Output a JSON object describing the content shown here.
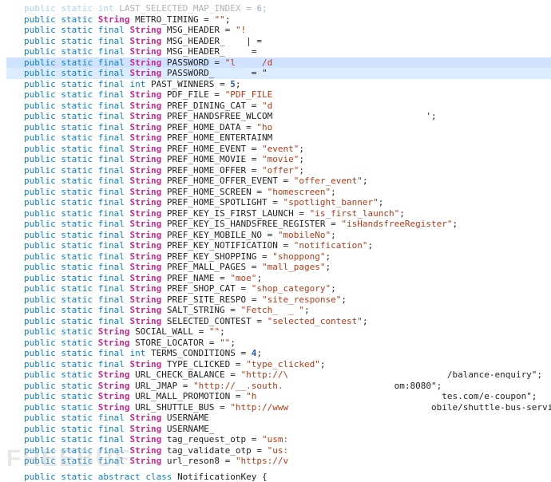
{
  "watermark": "FREEBUF",
  "code": {
    "lines": [
      {
        "indent": 1,
        "mods": "public static ",
        "type": "int",
        "sp": " ",
        "name": "LAST_SELECTED_MAP_INDEX",
        "eq": " = ",
        "valkind": "num",
        "val": "6",
        "tail": ";",
        "faded": true
      },
      {
        "indent": 1,
        "mods": "public static ",
        "type": "String",
        "sp": " ",
        "name": "METRO_TIMING",
        "eq": " = ",
        "valkind": "str",
        "val": "\"\"",
        "tail": ";"
      },
      {
        "indent": 1,
        "mods": "public static final ",
        "type": "String",
        "sp": " ",
        "name": "MSG_HEADER",
        "eq": " = ",
        "valkind": "str",
        "val": "\"!",
        "tail": ""
      },
      {
        "indent": 1,
        "mods": "public static final ",
        "type": "String",
        "sp": " ",
        "name": "MSG_HEADER_",
        "eq": "",
        "valkind": "",
        "val": "",
        "tail": "    | ="
      },
      {
        "indent": 1,
        "mods": "public static final ",
        "type": "String",
        "sp": " ",
        "name": "MSG_HEADER_",
        "eq": "",
        "valkind": "",
        "val": "",
        "tail": "     ="
      },
      {
        "indent": 1,
        "hl": true,
        "mods": "public static final ",
        "type": "String",
        "sp": " ",
        "name": "PASSWORD",
        "eq": " = ",
        "valkind": "str",
        "val": "\"l     /d",
        "tail": ""
      },
      {
        "indent": 1,
        "hl2": true,
        "mods": "public static final ",
        "type": "String",
        "sp": " ",
        "name": "PASSWORD_",
        "eq": "",
        "valkind": "",
        "val": "",
        "tail": "       = \""
      },
      {
        "indent": 1,
        "mods": "public static final ",
        "type": "int",
        "sp": " ",
        "name": "PAST_WINNERS",
        "eq": " = ",
        "valkind": "num",
        "val": "5",
        "tail": ";"
      },
      {
        "indent": 1,
        "mods": "public static final ",
        "type": "String",
        "sp": " ",
        "name": "PDF_FILE",
        "eq": " = ",
        "valkind": "str",
        "val": "\"PDF_FILE",
        "tail": ""
      },
      {
        "indent": 1,
        "mods": "public static final ",
        "type": "String",
        "sp": " ",
        "name": "PREF_DINING_CAT",
        "eq": " = ",
        "valkind": "str",
        "val": "\"d",
        "tail": ""
      },
      {
        "indent": 1,
        "mods": "public static final ",
        "type": "String",
        "sp": " ",
        "name": "PREF_HANDSFREE_WLCOM",
        "eq": "",
        "valkind": "",
        "val": "",
        "tail": "                             ';"
      },
      {
        "indent": 1,
        "mods": "public static final ",
        "type": "String",
        "sp": " ",
        "name": "PREF_HOME_DATA",
        "eq": " = ",
        "valkind": "str",
        "val": "\"ho",
        "tail": ""
      },
      {
        "indent": 1,
        "mods": "public static final ",
        "type": "String",
        "sp": " ",
        "name": "PREF_HOME_ENTERTAINM",
        "eq": "",
        "valkind": "",
        "val": "",
        "tail": ""
      },
      {
        "indent": 1,
        "mods": "public static final ",
        "type": "String",
        "sp": " ",
        "name": "PREF_HOME_EVENT",
        "eq": " = ",
        "valkind": "str",
        "val": "\"event\"",
        "tail": ";"
      },
      {
        "indent": 1,
        "mods": "public static final ",
        "type": "String",
        "sp": " ",
        "name": "PREF_HOME_MOVIE",
        "eq": " = ",
        "valkind": "str",
        "val": "\"movie\"",
        "tail": ";"
      },
      {
        "indent": 1,
        "mods": "public static final ",
        "type": "String",
        "sp": " ",
        "name": "PREF_HOME_OFFER",
        "eq": " = ",
        "valkind": "str",
        "val": "\"offer\"",
        "tail": ";"
      },
      {
        "indent": 1,
        "mods": "public static final ",
        "type": "String",
        "sp": " ",
        "name": "PREF_HOME_OFFER_EVENT",
        "eq": " = ",
        "valkind": "str",
        "val": "\"offer_event\"",
        "tail": ";"
      },
      {
        "indent": 1,
        "mods": "public static final ",
        "type": "String",
        "sp": " ",
        "name": "PREF_HOME_SCREEN",
        "eq": " = ",
        "valkind": "str",
        "val": "\"homescreen\"",
        "tail": ";"
      },
      {
        "indent": 1,
        "mods": "public static final ",
        "type": "String",
        "sp": " ",
        "name": "PREF_HOME_SPOTLIGHT",
        "eq": " = ",
        "valkind": "str",
        "val": "\"spotlight_banner\"",
        "tail": ";"
      },
      {
        "indent": 1,
        "mods": "public static final ",
        "type": "String",
        "sp": " ",
        "name": "PREF_KEY_IS_FIRST_LAUNCH",
        "eq": " = ",
        "valkind": "str",
        "val": "\"is_first_launch\"",
        "tail": ";"
      },
      {
        "indent": 1,
        "mods": "public static final ",
        "type": "String",
        "sp": " ",
        "name": "PREF_KEY_IS_HANDSFREE_REGISTER",
        "eq": " = ",
        "valkind": "str",
        "val": "\"isHandsfreeRegister\"",
        "tail": ";"
      },
      {
        "indent": 1,
        "mods": "public static final ",
        "type": "String",
        "sp": " ",
        "name": "PREF_KEY_MOBILE_NO",
        "eq": " = ",
        "valkind": "str",
        "val": "\"mobileNo\"",
        "tail": ";"
      },
      {
        "indent": 1,
        "mods": "public static final ",
        "type": "String",
        "sp": " ",
        "name": "PREF_KEY_NOTIFICATION",
        "eq": " = ",
        "valkind": "str",
        "val": "\"notification\"",
        "tail": ";"
      },
      {
        "indent": 1,
        "mods": "public static final ",
        "type": "String",
        "sp": " ",
        "name": "PREF_KEY_SHOPPING",
        "eq": " = ",
        "valkind": "str",
        "val": "\"shoppong\"",
        "tail": ";"
      },
      {
        "indent": 1,
        "mods": "public static final ",
        "type": "String",
        "sp": " ",
        "name": "PREF_MALL_PAGES",
        "eq": " = ",
        "valkind": "str",
        "val": "\"mall_pages\"",
        "tail": ";"
      },
      {
        "indent": 1,
        "mods": "public static final ",
        "type": "String",
        "sp": " ",
        "name": "PREF_NAME",
        "eq": " = ",
        "valkind": "str",
        "val": "\"moe\"",
        "tail": ";"
      },
      {
        "indent": 1,
        "mods": "public static final ",
        "type": "String",
        "sp": " ",
        "name": "PREF_SHOP_CAT",
        "eq": " = ",
        "valkind": "str",
        "val": "\"shop_category\"",
        "tail": ";"
      },
      {
        "indent": 1,
        "mods": "public static final ",
        "type": "String",
        "sp": " ",
        "name": "PREF_SITE_RESPO",
        "eq": " = ",
        "valkind": "str",
        "val": "\"site_response\"",
        "tail": ";"
      },
      {
        "indent": 1,
        "mods": "public static final ",
        "type": "String",
        "sp": " ",
        "name": "SALT_STRING",
        "eq": " = ",
        "valkind": "str",
        "val": "\"Fetch_  _ \"",
        "tail": ";"
      },
      {
        "indent": 1,
        "mods": "public static final ",
        "type": "String",
        "sp": " ",
        "name": "SELECTED_CONTEST",
        "eq": " = ",
        "valkind": "str",
        "val": "\"selected_contest\"",
        "tail": ";"
      },
      {
        "indent": 1,
        "mods": "public static ",
        "type": "String",
        "sp": " ",
        "name": "SOCIAL_WALL",
        "eq": " = ",
        "valkind": "str",
        "val": "\"\"",
        "tail": ";"
      },
      {
        "indent": 1,
        "mods": "public static ",
        "type": "String",
        "sp": " ",
        "name": "STORE_LOCATOR",
        "eq": " = ",
        "valkind": "str",
        "val": "\"\"",
        "tail": ";"
      },
      {
        "indent": 1,
        "mods": "public static final ",
        "type": "int",
        "sp": " ",
        "name": "TERMS_CONDITIONS",
        "eq": " = ",
        "valkind": "num",
        "val": "4",
        "tail": ";"
      },
      {
        "indent": 1,
        "mods": "public static final ",
        "type": "String",
        "sp": " ",
        "name": "TYPE_CLICKED",
        "eq": " = ",
        "valkind": "str",
        "val": "\"type_clicked\"",
        "tail": ";"
      },
      {
        "indent": 1,
        "mods": "public static ",
        "type": "String",
        "sp": " ",
        "name": "URL_CHECK_BALANCE",
        "eq": " = ",
        "valkind": "str",
        "val": "\"http://\\",
        "tail": "                              /balance-enquiry\";"
      },
      {
        "indent": 1,
        "mods": "public static ",
        "type": "String",
        "sp": " ",
        "name": "URL_JMAP",
        "eq": " = ",
        "valkind": "str",
        "val": "\"http://__.south.",
        "tail": "                     om:8080\";"
      },
      {
        "indent": 1,
        "mods": "public static ",
        "type": "String",
        "sp": " ",
        "name": "URL_MALL_PROMOTION",
        "eq": " = ",
        "valkind": "str",
        "val": "\"h",
        "tail": "                                   tes.com/e-coupon\";"
      },
      {
        "indent": 1,
        "mods": "public static ",
        "type": "String",
        "sp": " ",
        "name": "URL_SHUTTLE_BUS",
        "eq": " = ",
        "valkind": "str",
        "val": "\"http://www",
        "tail": "                           obile/shuttle-bus-service\";"
      },
      {
        "indent": 1,
        "mods": "public static final ",
        "type": "String",
        "sp": " ",
        "name": "USERNAME",
        "eq": "",
        "valkind": "",
        "val": "",
        "tail": ""
      },
      {
        "indent": 1,
        "mods": "public static final ",
        "type": "String",
        "sp": " ",
        "name": "USERNAME_",
        "eq": "",
        "valkind": "",
        "val": "",
        "tail": ""
      },
      {
        "indent": 1,
        "mods": "public static final ",
        "type": "String",
        "sp": " ",
        "name": "tag_request_otp",
        "eq": " = ",
        "valkind": "str",
        "val": "\"usm:",
        "tail": ""
      },
      {
        "indent": 1,
        "mods": "public static final ",
        "type": "String",
        "sp": " ",
        "name": "tag_validate_otp",
        "eq": " = ",
        "valkind": "str",
        "val": "\"us:",
        "tail": ""
      },
      {
        "indent": 1,
        "mods": "public static final ",
        "type": "String",
        "sp": " ",
        "name": "url_reson8",
        "eq": " = ",
        "valkind": "str",
        "val": "\"https://v",
        "tail": ""
      },
      {
        "blank": true
      },
      {
        "indent": 1,
        "mods": "public static abstract class ",
        "type": "",
        "sp": "",
        "name": "NotificationKey",
        "eq": "",
        "valkind": "",
        "val": "",
        "tail": " {"
      }
    ]
  }
}
